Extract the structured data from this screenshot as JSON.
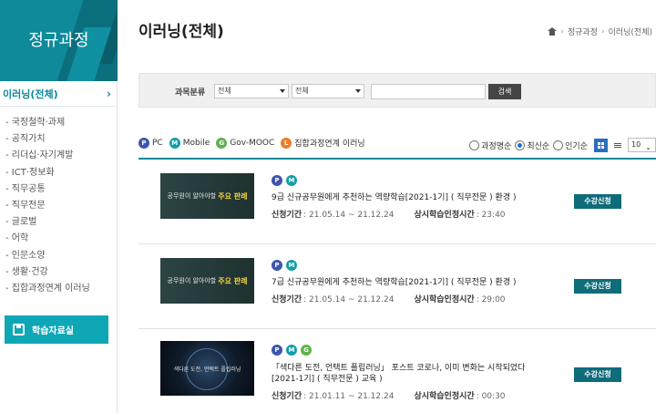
{
  "sidebar": {
    "banner_title": "정규과정",
    "category": "이러닝(전체)",
    "items": [
      {
        "label": "- 국정철학·과제"
      },
      {
        "label": "- 공직가치"
      },
      {
        "label": "- 리더십·자기계발"
      },
      {
        "label": "- ICT·정보화"
      },
      {
        "label": "- 직무공통"
      },
      {
        "label": "- 직무전문"
      },
      {
        "label": "- 글로벌"
      },
      {
        "label": "- 어학"
      },
      {
        "label": "- 인문소양"
      },
      {
        "label": "- 생활·건강"
      },
      {
        "label": "- 집합과정연계 이러닝"
      }
    ],
    "resource_button": "학습자료실"
  },
  "main": {
    "title": "이러닝(전체)",
    "breadcrumb": [
      "정규과정",
      "이러닝(전체)"
    ]
  },
  "filter": {
    "label": "과목분류",
    "select1": "전체",
    "select2": "전체",
    "search_value": "",
    "search_button": "검색"
  },
  "legend": [
    {
      "badge": "P",
      "label": "PC"
    },
    {
      "badge": "M",
      "label": "Mobile"
    },
    {
      "badge": "G",
      "label": "Gov-MOOC"
    },
    {
      "badge": "L",
      "label": "집합과정연계 이러닝"
    }
  ],
  "sort": {
    "options": [
      "과정명순",
      "최신순",
      "인기순"
    ],
    "selected": "최신순",
    "page_size": "10"
  },
  "courses": [
    {
      "thumb_text": "공무원이 알아야할",
      "thumb_highlight": "주요 판례",
      "badges": [
        "P",
        "M"
      ],
      "title": "9급 신규공무원에게 추천하는 역량학습[2021-1기] ( 직무전문 ) 환경 )",
      "period_label": "신청기간",
      "period": ": 21.05.14 ~ 21.12.24",
      "time_label": "상시학습인정시간",
      "time": ": 23:40",
      "button": "수강신청"
    },
    {
      "thumb_text": "공무원이 알아야할",
      "thumb_highlight": "주요 판례",
      "badges": [
        "P",
        "M"
      ],
      "title": "7급 신규공무원에게 추천하는 역량학습[2021-1기] ( 직무전문 ) 환경 )",
      "period_label": "신청기간",
      "period": ": 21.05.14 ~ 21.12.24",
      "time_label": "상시학습인정시간",
      "time": ": 29:00",
      "button": "수강신청"
    },
    {
      "thumb_text": "색다른 도전, 언택트 플립러닝",
      "badges": [
        "P",
        "M",
        "G"
      ],
      "title": "「색다른 도전, 언택트 플립러닝」 포스트 코로나, 이미 변화는 시작되었다[2021-1기] ( 직무전문 ) 교육 )",
      "period_label": "신청기간",
      "period": ": 21.01.11 ~ 21.12.24",
      "time_label": "상시학습인정시간",
      "time": ": 00:30",
      "button": "수강신청"
    }
  ]
}
